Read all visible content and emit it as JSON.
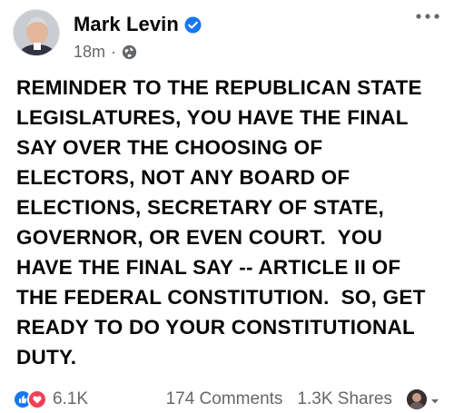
{
  "post": {
    "author": {
      "name": "Mark Levin",
      "verified": true
    },
    "meta": {
      "time": "18m",
      "separator": "·",
      "audience_icon": "globe-icon"
    },
    "text": "REMINDER TO THE REPUBLICAN STATE\nLEGISLATURES, YOU HAVE THE FINAL\nSAY OVER THE CHOOSING OF\nELECTORS, NOT ANY BOARD OF\nELECTIONS, SECRETARY OF STATE,\nGOVERNOR, OR EVEN COURT.  YOU\nHAVE THE FINAL SAY -- ARTICLE II OF\nTHE FEDERAL CONSTITUTION.  SO, GET\nREADY TO DO YOUR CONSTITUTIONAL\nDUTY.",
    "footer": {
      "reactions_count": "6.1K",
      "comments": "174 Comments",
      "shares": "1.3K Shares"
    }
  },
  "colors": {
    "like_blue": "#1877f2",
    "love_red": "#f33e58",
    "verified_blue": "#1877f2",
    "meta_gray": "#65676b",
    "text": "#050505"
  }
}
